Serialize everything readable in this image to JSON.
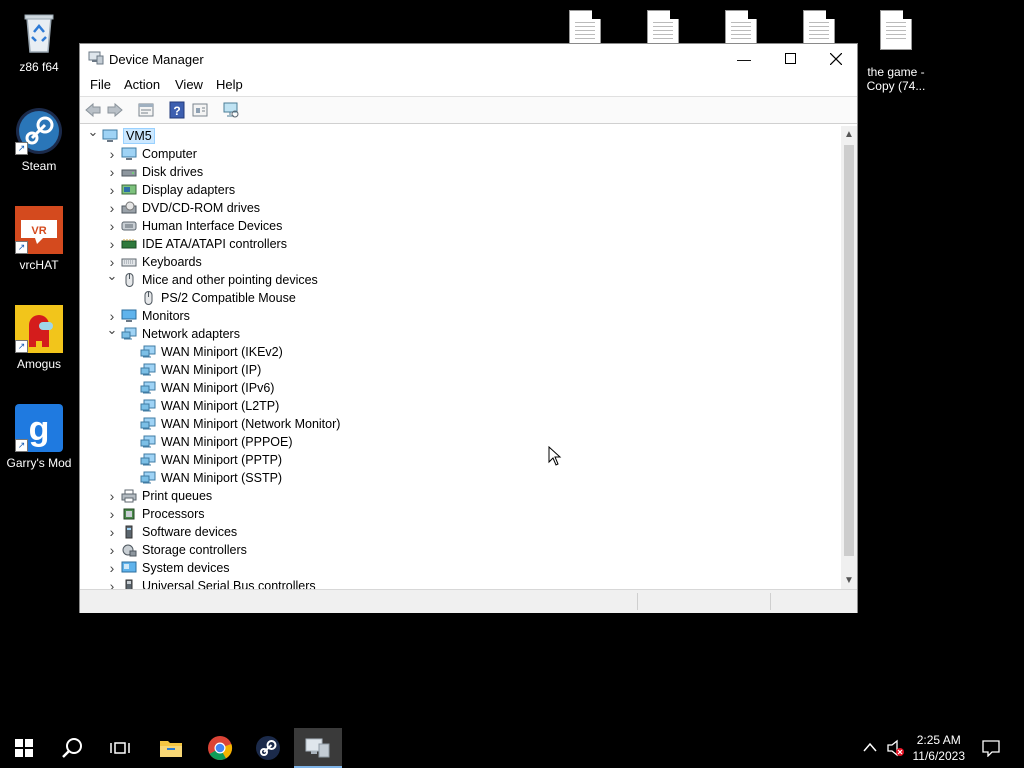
{
  "desktop": {
    "icons": [
      {
        "label": "z86 f64",
        "icon": "recycle-bin-icon"
      },
      {
        "label": "Steam",
        "icon": "steam-icon"
      },
      {
        "label": "vrcHAT",
        "icon": "vrchat-icon"
      },
      {
        "label": "Amogus",
        "icon": "among-us-icon"
      },
      {
        "label": "Garry's Mod",
        "icon": "garrys-mod-icon"
      }
    ],
    "files": [
      {
        "label": ""
      },
      {
        "label": ""
      },
      {
        "label": ""
      },
      {
        "label": ""
      },
      {
        "label": "the game -\nCopy (74..."
      }
    ]
  },
  "window": {
    "title": "Device Manager",
    "menu": [
      "File",
      "Action",
      "View",
      "Help"
    ],
    "tree": {
      "root": "VM5",
      "items": [
        {
          "label": "Computer",
          "expanded": false,
          "icon": "computer-icon"
        },
        {
          "label": "Disk drives",
          "expanded": false,
          "icon": "disk-drive-icon"
        },
        {
          "label": "Display adapters",
          "expanded": false,
          "icon": "display-adapter-icon"
        },
        {
          "label": "DVD/CD-ROM drives",
          "expanded": false,
          "icon": "dvd-drive-icon"
        },
        {
          "label": "Human Interface Devices",
          "expanded": false,
          "icon": "hid-icon"
        },
        {
          "label": "IDE ATA/ATAPI controllers",
          "expanded": false,
          "icon": "ide-controller-icon"
        },
        {
          "label": "Keyboards",
          "expanded": false,
          "icon": "keyboard-icon"
        },
        {
          "label": "Mice and other pointing devices",
          "expanded": true,
          "icon": "mouse-icon",
          "children": [
            "PS/2 Compatible Mouse"
          ]
        },
        {
          "label": "Monitors",
          "expanded": false,
          "icon": "monitor-icon"
        },
        {
          "label": "Network adapters",
          "expanded": true,
          "icon": "network-adapter-icon",
          "children": [
            "WAN Miniport (IKEv2)",
            "WAN Miniport (IP)",
            "WAN Miniport (IPv6)",
            "WAN Miniport (L2TP)",
            "WAN Miniport (Network Monitor)",
            "WAN Miniport (PPPOE)",
            "WAN Miniport (PPTP)",
            "WAN Miniport (SSTP)"
          ]
        },
        {
          "label": "Print queues",
          "expanded": false,
          "icon": "printer-icon"
        },
        {
          "label": "Processors",
          "expanded": false,
          "icon": "processor-icon"
        },
        {
          "label": "Software devices",
          "expanded": false,
          "icon": "software-device-icon"
        },
        {
          "label": "Storage controllers",
          "expanded": false,
          "icon": "storage-controller-icon"
        },
        {
          "label": "System devices",
          "expanded": false,
          "icon": "system-device-icon"
        },
        {
          "label": "Universal Serial Bus controllers",
          "expanded": false,
          "icon": "usb-icon"
        }
      ]
    }
  },
  "taskbar": {
    "time": "2:25 AM",
    "date": "11/6/2023"
  },
  "colors": {
    "selection": "#cce8ff",
    "accent": "#0078d7"
  }
}
